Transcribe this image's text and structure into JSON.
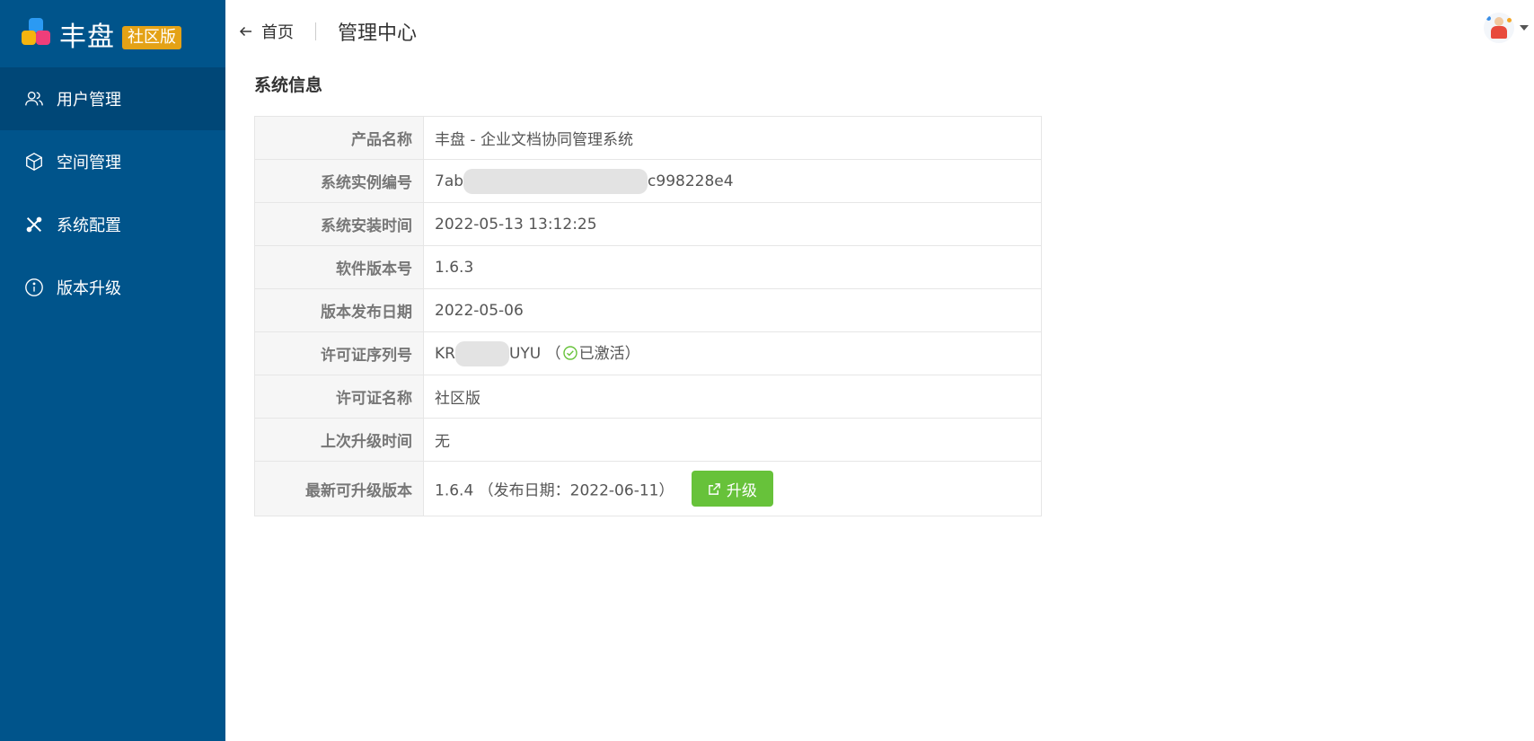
{
  "app": {
    "name": "丰盘",
    "edition_badge": "社区版"
  },
  "sidebar": {
    "items": [
      {
        "label": "用户管理",
        "icon": "users-icon",
        "active": true
      },
      {
        "label": "空间管理",
        "icon": "cube-icon",
        "active": false
      },
      {
        "label": "系统配置",
        "icon": "tools-icon",
        "active": false
      },
      {
        "label": "版本升级",
        "icon": "info-icon",
        "active": false
      }
    ]
  },
  "header": {
    "back_label": "首页",
    "title": "管理中心"
  },
  "section": {
    "title": "系统信息"
  },
  "info": {
    "product_name": {
      "label": "产品名称",
      "value": "丰盘 - 企业文档协同管理系统"
    },
    "instance_id": {
      "label": "系统实例编号",
      "prefix": "7ab",
      "suffix": "c998228e4"
    },
    "install_time": {
      "label": "系统安装时间",
      "value": "2022-05-13 13:12:25"
    },
    "software_version": {
      "label": "软件版本号",
      "value": "1.6.3"
    },
    "release_date": {
      "label": "版本发布日期",
      "value": "2022-05-06"
    },
    "license_serial": {
      "label": "许可证序列号",
      "prefix": "KR",
      "suffix": "UYU",
      "status_open": "（",
      "status": "已激活",
      "status_close": "）"
    },
    "license_name": {
      "label": "许可证名称",
      "value": "社区版"
    },
    "last_upgrade": {
      "label": "上次升级时间",
      "value": "无"
    },
    "latest_version": {
      "label": "最新可升级版本",
      "value": "1.6.4 （发布日期：2022-06-11）",
      "button_label": "升级"
    }
  },
  "colors": {
    "sidebar_bg": "#00548b",
    "sidebar_active": "#004777",
    "badge": "#e4a216",
    "success": "#67c23a"
  }
}
